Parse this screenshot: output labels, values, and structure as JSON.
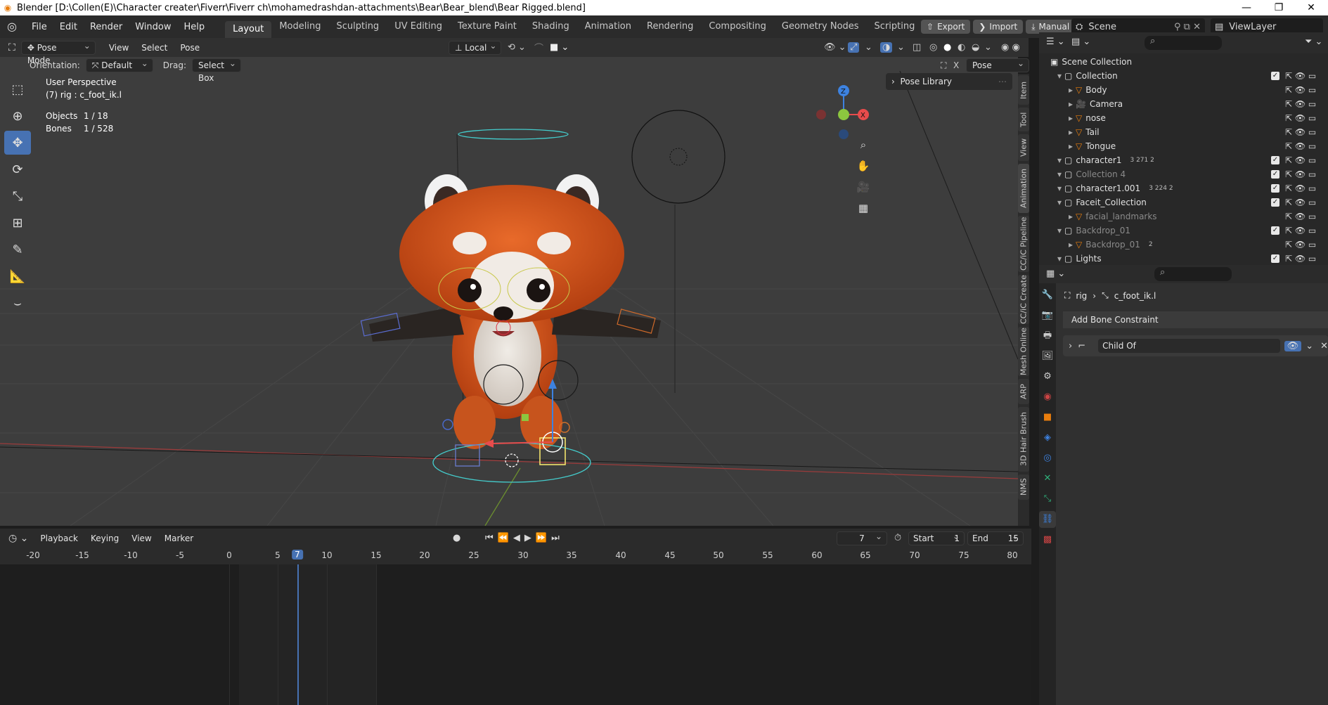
{
  "window": {
    "title": "Blender [D:\\Collen(E)\\Character creater\\Fiverr\\Fiverr ch\\mohamedrashdan-attachments\\Bear\\Bear_blend\\Bear Rigged.blend]",
    "minimize": "—",
    "restore": "❐",
    "close": "✕"
  },
  "menu": [
    "File",
    "Edit",
    "Render",
    "Window",
    "Help"
  ],
  "workspaces": [
    "Layout",
    "Modeling",
    "Sculpting",
    "UV Editing",
    "Texture Paint",
    "Shading",
    "Animation",
    "Rendering",
    "Compositing",
    "Geometry Nodes",
    "Scripting"
  ],
  "workspace_add": "+",
  "topright": {
    "export_label": "Export",
    "import_label": "Import",
    "manual_label": "Manual",
    "scene_name": "Scene",
    "viewlayer_name": "ViewLayer"
  },
  "viewport_header": {
    "mode": "Pose Mode",
    "menus": [
      "View",
      "Select",
      "Pose"
    ],
    "transform_space": "Local",
    "orientation_label": "Orientation:",
    "orientation_value": "Default",
    "drag_label": "Drag:",
    "drag_value": "Select Box",
    "pose_options": "Pose Options"
  },
  "viewport_info": {
    "perspective": "User Perspective",
    "context": "(7) rig : c_foot_ik.l",
    "objects_label": "Objects",
    "objects_value": "1 / 18",
    "bones_label": "Bones",
    "bones_value": "1 / 528"
  },
  "gizmo_axes": {
    "z": "Z",
    "x": "X"
  },
  "pose_library": "Pose Library",
  "side_tabs": [
    "Item",
    "Tool",
    "View",
    "Animation",
    "CC/iC Pipeline",
    "CC/iC Create",
    "Mesh Online",
    "ARP",
    "3D Hair Brush",
    "NMS"
  ],
  "timeline": {
    "menus": [
      "Playback",
      "Keying",
      "View",
      "Marker"
    ],
    "current_frame": "7",
    "start_label": "Start",
    "start_value": "1",
    "end_label": "End",
    "end_value": "15",
    "ticks": [
      "-20",
      "-15",
      "-10",
      "-5",
      "0",
      "5",
      "7",
      "10",
      "15",
      "20",
      "25",
      "30",
      "35",
      "40",
      "45",
      "50",
      "55",
      "60",
      "65",
      "70",
      "75",
      "80"
    ]
  },
  "outliner": {
    "root": "Scene Collection",
    "rows": [
      {
        "label": "Collection",
        "indent": 1,
        "icon": "collection",
        "dim": false
      },
      {
        "label": "Body",
        "indent": 2,
        "icon": "mesh",
        "dim": false
      },
      {
        "label": "Camera",
        "indent": 2,
        "icon": "camera",
        "dim": false
      },
      {
        "label": "nose",
        "indent": 2,
        "icon": "mesh",
        "dim": false
      },
      {
        "label": "Tail",
        "indent": 2,
        "icon": "mesh",
        "dim": false
      },
      {
        "label": "Tongue",
        "indent": 2,
        "icon": "mesh",
        "dim": false
      },
      {
        "label": "character1",
        "indent": 1,
        "icon": "collection",
        "dim": false,
        "badges": "3  271  2"
      },
      {
        "label": "Collection 4",
        "indent": 1,
        "icon": "collection",
        "dim": true
      },
      {
        "label": "character1.001",
        "indent": 1,
        "icon": "collection",
        "dim": false,
        "badges": "3  224  2"
      },
      {
        "label": "Faceit_Collection",
        "indent": 1,
        "icon": "collection",
        "dim": false
      },
      {
        "label": "facial_landmarks",
        "indent": 2,
        "icon": "mesh",
        "dim": true
      },
      {
        "label": "Backdrop_01",
        "indent": 1,
        "icon": "collection",
        "dim": true
      },
      {
        "label": "Backdrop_01",
        "indent": 2,
        "icon": "mesh",
        "dim": true,
        "badges": "2"
      },
      {
        "label": "Lights",
        "indent": 1,
        "icon": "collection",
        "dim": false
      }
    ]
  },
  "properties": {
    "crumb_object": "rig",
    "crumb_bone": "c_foot_ik.l",
    "add_constraint": "Add Bone Constraint",
    "constraint_name": "Child Of"
  },
  "colors": {
    "accent": "#4772b3",
    "axis_x": "#e84c4c",
    "axis_y": "#8cc63f",
    "axis_z": "#3d82e0",
    "panda_orange": "#d9531e"
  }
}
